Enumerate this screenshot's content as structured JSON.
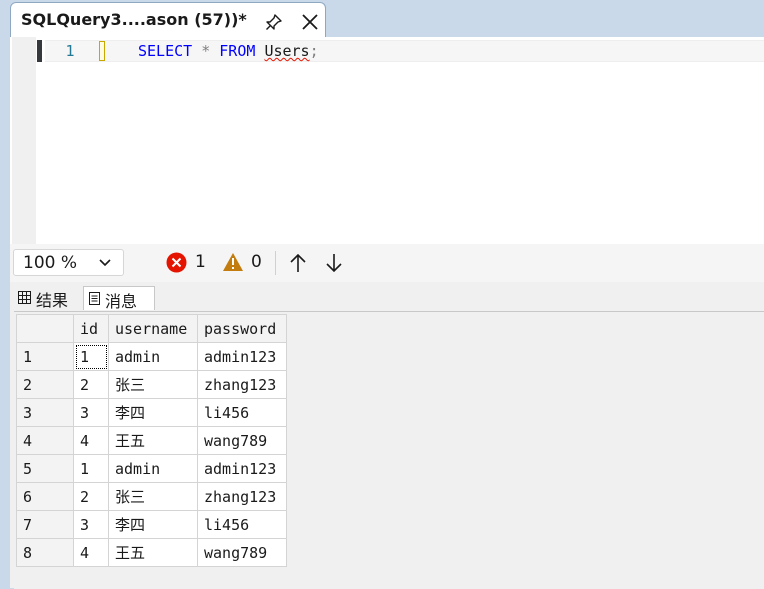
{
  "tab": {
    "title": "SQLQuery3....ason (57))*"
  },
  "editor": {
    "line_number": "1",
    "code": {
      "kw1": "SELECT",
      "star": " * ",
      "kw2": "FROM",
      "table": "Users",
      "semi": ";"
    }
  },
  "status": {
    "zoom": "100 %",
    "errors": "1",
    "warnings": "0"
  },
  "results_tabs": {
    "results": "结果",
    "messages": "消息"
  },
  "grid": {
    "columns": [
      "id",
      "username",
      "password"
    ],
    "rows": [
      {
        "num": "1",
        "id": "1",
        "username": "admin",
        "password": "admin123"
      },
      {
        "num": "2",
        "id": "2",
        "username": "张三",
        "password": "zhang123"
      },
      {
        "num": "3",
        "id": "3",
        "username": "李四",
        "password": "li456"
      },
      {
        "num": "4",
        "id": "4",
        "username": "王五",
        "password": "wang789"
      },
      {
        "num": "5",
        "id": "1",
        "username": "admin",
        "password": "admin123"
      },
      {
        "num": "6",
        "id": "2",
        "username": "张三",
        "password": "zhang123"
      },
      {
        "num": "7",
        "id": "3",
        "username": "李四",
        "password": "li456"
      },
      {
        "num": "8",
        "id": "4",
        "username": "王五",
        "password": "wang789"
      }
    ]
  },
  "colors": {
    "keyword": "#0000ff",
    "error": "#e51400",
    "warning": "#c27d0e",
    "linenumber": "#237893"
  }
}
